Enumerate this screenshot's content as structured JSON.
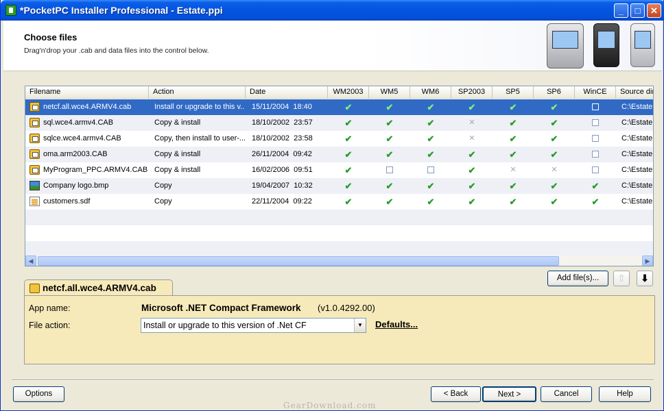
{
  "window": {
    "title": "*PocketPC Installer Professional - Estate.ppi",
    "controls": [
      "_",
      "□",
      "✕"
    ]
  },
  "header": {
    "title": "Choose files",
    "subtitle": "Drag'n'drop your .cab and data files into the control below."
  },
  "list": {
    "columns": [
      "Filename",
      "Action",
      "Date",
      "WM2003",
      "WM5",
      "WM6",
      "SP2003",
      "SP5",
      "SP6",
      "WinCE",
      "Source dir"
    ],
    "rows": [
      {
        "icon": "cab-file-icon",
        "name": "netcf.all.wce4.ARMV4.cab",
        "action": "Install or upgrade to this v...",
        "date": "15/11/2004  18:40",
        "flags": [
          "check",
          "check",
          "check",
          "check",
          "check",
          "check",
          "box"
        ],
        "source": "C:\\Estate",
        "selected": true
      },
      {
        "icon": "cab-file-icon",
        "name": "sql.wce4.armv4.CAB",
        "action": "Copy & install",
        "date": "18/10/2002  23:57",
        "flags": [
          "check",
          "check",
          "check",
          "x",
          "check",
          "check",
          "box"
        ],
        "source": "C:\\Estate."
      },
      {
        "icon": "cab-file-icon",
        "name": "sqlce.wce4.armv4.CAB",
        "action": "Copy, then install to user-...",
        "date": "18/10/2002  23:58",
        "flags": [
          "check",
          "check",
          "check",
          "x",
          "check",
          "check",
          "box"
        ],
        "source": "C:\\Estate."
      },
      {
        "icon": "cab-file-icon",
        "name": "oma.arm2003.CAB",
        "action": "Copy & install",
        "date": "26/11/2004  09:42",
        "flags": [
          "check",
          "check",
          "check",
          "check",
          "check",
          "check",
          "box"
        ],
        "source": "C:\\Estate."
      },
      {
        "icon": "cab-file-icon",
        "name": "MyProgram_PPC.ARMV4.CAB",
        "action": "Copy & install",
        "date": "16/02/2006  09:51",
        "flags": [
          "check",
          "box",
          "box",
          "check",
          "x",
          "x",
          "box"
        ],
        "source": "C:\\Estate."
      },
      {
        "icon": "bitmap-file-icon",
        "name": "Company logo.bmp",
        "action": "Copy",
        "date": "19/04/2007  10:32",
        "flags": [
          "check",
          "check",
          "check",
          "check",
          "check",
          "check",
          "check"
        ],
        "source": "C:\\Estate."
      },
      {
        "icon": "database-file-icon",
        "name": "customers.sdf",
        "action": "Copy",
        "date": "22/11/2004  09:22",
        "flags": [
          "check",
          "check",
          "check",
          "check",
          "check",
          "check",
          "check"
        ],
        "source": "C:\\Estate."
      }
    ]
  },
  "toolbar": {
    "add_files": "Add file(s)...",
    "add_files_key": "A",
    "up_icon": "up-arrow-icon",
    "down_icon": "down-arrow-icon"
  },
  "details": {
    "tab_title": "netcf.all.wce4.ARMV4.cab",
    "app_name_label": "App name:",
    "app_name": "Microsoft .NET Compact Framework",
    "app_version": "(v1.0.4292.00)",
    "file_action_label": "File action:",
    "file_action_value": "Install or upgrade to this version of .Net CF",
    "defaults_link": "Defaults..."
  },
  "footer": {
    "options": "Options",
    "back": "< Back",
    "next": "Next >",
    "cancel": "Cancel",
    "help": "Help"
  },
  "watermark": "GearDownload.com",
  "colors": {
    "selection": "#316AC5",
    "panel": "#F7EABA",
    "check": "#2E9B2E",
    "titlebar": "#0554E0"
  }
}
